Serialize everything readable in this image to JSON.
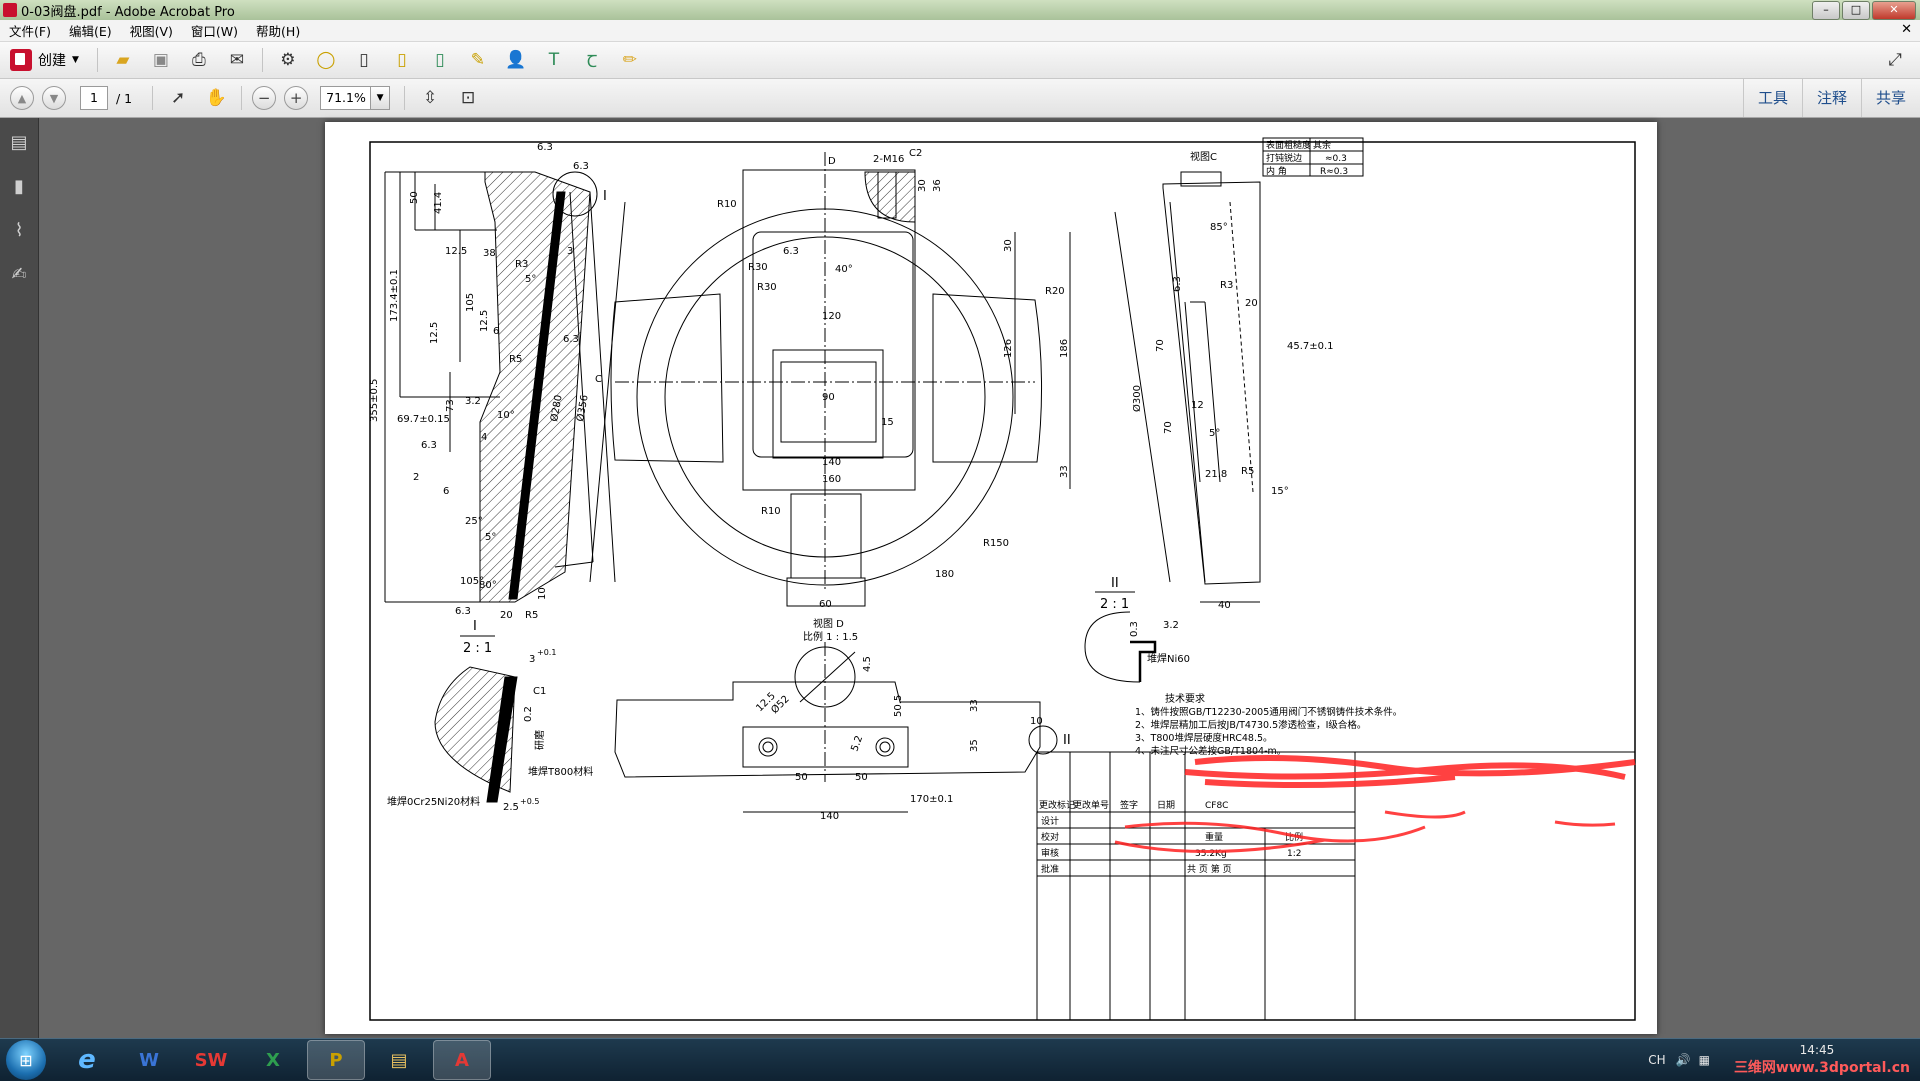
{
  "window": {
    "title": "0-03阀盘.pdf - Adobe Acrobat Pro",
    "min_label": "–",
    "max_label": "□",
    "close_label": "✕"
  },
  "menu": {
    "items": [
      "文件(F)",
      "编辑(E)",
      "视图(V)",
      "窗口(W)",
      "帮助(H)"
    ],
    "close_doc": "✕"
  },
  "toolbar": {
    "create_label": "创建"
  },
  "nav": {
    "page_current": "1",
    "page_total": "/ 1",
    "zoom": "71.1%"
  },
  "right_panel": {
    "tools": "工具",
    "comment": "注释",
    "share": "共享"
  },
  "drawing": {
    "view_c": "视图C",
    "view_d": "视图 D",
    "view_d_scale": "比例 1 : 1.5",
    "detail_i": "I",
    "detail_i_scale": "2 : 1",
    "detail_ii": "II",
    "detail_ii_scale": "2 : 1",
    "roughness_table": [
      [
        "表面粗糙度",
        "其余"
      ],
      [
        "打钝锐边",
        "≈0.3"
      ],
      [
        "内    角",
        "R≈0.3"
      ]
    ],
    "tech_title": "技术要求",
    "tech_items": [
      "1、铸件按照GB/T12230-2005通用阀门不锈钢铸件技术条件。",
      "2、堆焊层精加工后按JB/T4730.5渗透检查，I级合格。",
      "3、T800堆焊层硬度HRC48.5。",
      "4、未注尺寸公差按GB/T1804-m。"
    ],
    "weld_t800": "堆焊T800材料",
    "weld_ocr": "堆焊0Cr25Ni20材料",
    "weld_ni60": "堆焊Ni60",
    "grind": "研磨",
    "title_block": {
      "change_row": [
        "更改标记",
        "更改单号",
        "签字",
        "日期"
      ],
      "rows": [
        "设计",
        "校对",
        "审核",
        "批准"
      ],
      "material": "CF8C",
      "weight_label": "重量",
      "scale_label": "比例",
      "weight": "35.2Kg",
      "scale": "1:2",
      "sheets": "共    页    第    页"
    },
    "dims": {
      "d63a": "6.3",
      "d63b": "6.3",
      "d50": "50",
      "d414": "41.4",
      "d173": "173.4±0.1",
      "d125a": "12.5",
      "d38": "38",
      "d3": "3",
      "d105": "105",
      "d125b": "12.5",
      "d125c": "12.5",
      "d6a": "6",
      "d5a": "5°",
      "d63c": "6.3",
      "dR5a": "R5",
      "d355": "355±0.5",
      "d73": "73",
      "d32a": "3.2",
      "d10deg": "10°",
      "d697": "69.7±0.15",
      "d280": "Ø280",
      "d356": "Ø356",
      "d63d": "6.3",
      "d2": "2",
      "d4": "4",
      "d6b": "6",
      "d25deg": "25°",
      "d5b": "5°",
      "d105deg": "105°",
      "d80deg": "80°",
      "d63e": "6.3",
      "d20": "20",
      "dR5b": "R5",
      "dR3": "R3",
      "d10": "10",
      "dR30a": "R30",
      "dR30b": "R30",
      "dR10a": "R10",
      "dR10b": "R10",
      "d40deg": "40°",
      "d120": "120",
      "d90": "90",
      "d15": "15",
      "d140": "140",
      "d160": "160",
      "d180": "180",
      "d60": "60",
      "dR150": "R150",
      "dR20": "R20",
      "d30a": "30",
      "d126": "126",
      "d186": "186",
      "d33": "33",
      "dD": "D",
      "dC": "C",
      "d2M16": "2-M16",
      "dC2": "C2",
      "d30b": "30",
      "d36": "36",
      "d85deg": "85°",
      "dR3b": "R3",
      "d20b": "20",
      "d457": "45.7±0.1",
      "d635": "6.3",
      "dd70": "70",
      "d300": "Ø300",
      "d12": "12",
      "d70b": "70",
      "d5c": "5°",
      "d218": "21.8",
      "dR5c": "R5",
      "d15deg": "15°",
      "d40": "40",
      "d3b": "3",
      "d01": "+0.1",
      "dC1": "C1",
      "d02": "0.2",
      "d25": "2.5",
      "d05": "+0.5",
      "d03": "0.3",
      "d32b": "3.2",
      "d45": "4.5",
      "d125d": "12.5",
      "dO52": "Ø52",
      "d505": "50.5",
      "d33b": "33",
      "d35": "35",
      "d50a": "50",
      "d50b": "50",
      "d1701": "170±0.1",
      "d140b": "140",
      "d10b": "10",
      "d52": "5.2"
    }
  },
  "taskbar": {
    "start": "⊞",
    "ie": "e",
    "word": "W",
    "sw": "SW",
    "excel": "X",
    "pro": "P",
    "folder": "▤",
    "acrobat": "A"
  },
  "tray": {
    "lang": "CH",
    "time": "14:45",
    "site": "三维网www.3dportal.cn"
  }
}
